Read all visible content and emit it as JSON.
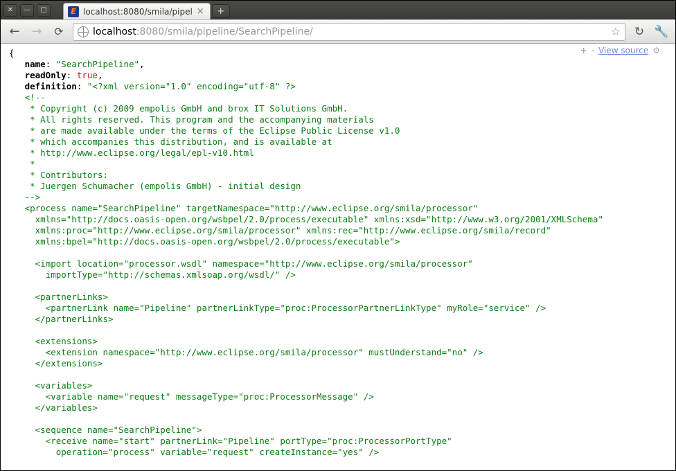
{
  "window": {
    "close_label": "✕",
    "min_label": "—",
    "max_label": "▢"
  },
  "tab": {
    "title": "localhost:8080/smila/pipel",
    "close": "×",
    "newtab": "+",
    "favicon_letter": "E"
  },
  "toolbar": {
    "back": "←",
    "forward": "→",
    "reload": "⟳",
    "url_host": "localhost",
    "url_rest": ":8080/smila/pipeline/SearchPipeline/",
    "star": "☆",
    "ext1": "↻",
    "wrench": "🔧"
  },
  "json_tools": {
    "plus": "+",
    "minus": "-",
    "view_source": "View source",
    "gear": "⚙"
  },
  "json": {
    "brace_open": "{",
    "name_key": "name",
    "name_val": "\"SearchPipeline\"",
    "readonly_key": "readOnly",
    "readonly_val": "true",
    "definition_key": "definition",
    "def_start": "\"<?xml version=\"1.0\" encoding=\"utf-8\" ?>",
    "lines": [
      "<!--",
      " * Copyright (c) 2009 empolis GmbH and brox IT Solutions GmbH.",
      " * All rights reserved. This program and the accompanying materials",
      " * are made available under the terms of the Eclipse Public License v1.0",
      " * which accompanies this distribution, and is available at",
      " * http://www.eclipse.org/legal/epl-v10.html",
      " *",
      " * Contributors:",
      " * Juergen Schumacher (empolis GmbH) - initial design",
      "-->",
      "<process name=\"SearchPipeline\" targetNamespace=\"http://www.eclipse.org/smila/processor\"",
      "  xmlns=\"http://docs.oasis-open.org/wsbpel/2.0/process/executable\" xmlns:xsd=\"http://www.w3.org/2001/XMLSchema\"",
      "  xmlns:proc=\"http://www.eclipse.org/smila/processor\" xmlns:rec=\"http://www.eclipse.org/smila/record\"",
      "  xmlns:bpel=\"http://docs.oasis-open.org/wsbpel/2.0/process/executable\">",
      "",
      "  <import location=\"processor.wsdl\" namespace=\"http://www.eclipse.org/smila/processor\"",
      "    importType=\"http://schemas.xmlsoap.org/wsdl/\" />",
      "",
      "  <partnerLinks>",
      "    <partnerLink name=\"Pipeline\" partnerLinkType=\"proc:ProcessorPartnerLinkType\" myRole=\"service\" />",
      "  </partnerLinks>",
      "",
      "  <extensions>",
      "    <extension namespace=\"http://www.eclipse.org/smila/processor\" mustUnderstand=\"no\" />",
      "  </extensions>",
      "",
      "  <variables>",
      "    <variable name=\"request\" messageType=\"proc:ProcessorMessage\" />",
      "  </variables>",
      "",
      "  <sequence name=\"SearchPipeline\">",
      "    <receive name=\"start\" partnerLink=\"Pipeline\" portType=\"proc:ProcessorPortType\"",
      "      operation=\"process\" variable=\"request\" createInstance=\"yes\" />"
    ]
  }
}
